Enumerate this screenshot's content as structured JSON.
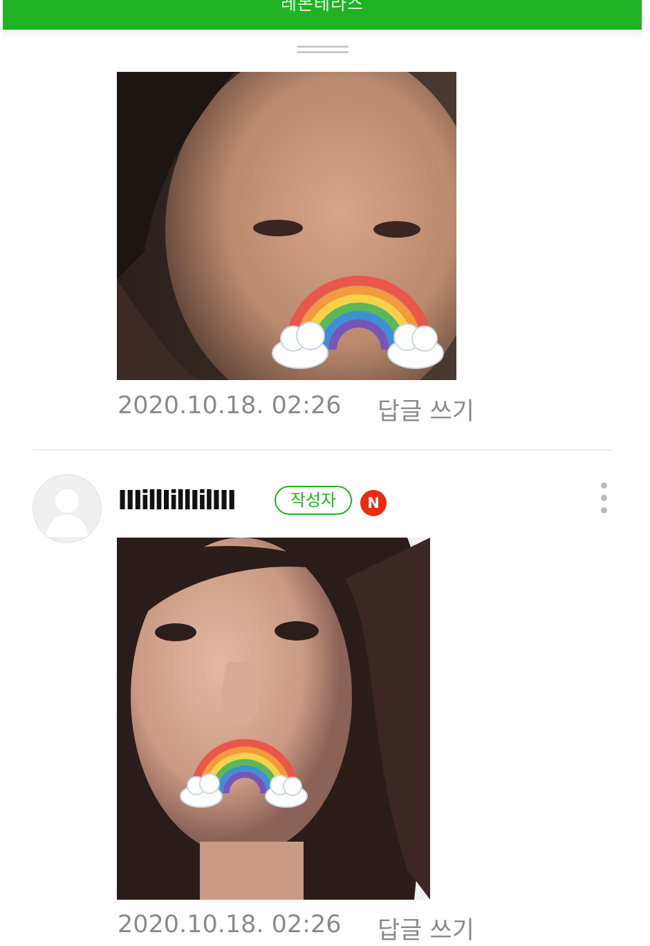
{
  "header": {
    "title": "레몬테라스",
    "background_color": "#1fb324",
    "back_icon": "chevron-left-icon"
  },
  "comments": [
    {
      "photo_description_icon": "photo-with-rainbow-sticker",
      "timestamp": "2020.10.18. 02:26",
      "reply_label": "답글 쓰기"
    },
    {
      "author": "IIIillIillIilIII",
      "writer_badge": "작성자",
      "new_badge": "N",
      "avatar_icon": "default-profile-icon",
      "more_icon": "more-vertical-icon",
      "photo_description_icon": "photo-with-rainbow-sticker",
      "timestamp": "2020.10.18. 02:26",
      "reply_label": "답글 쓰기"
    }
  ],
  "colors": {
    "accent": "#1fb324",
    "new_badge": "#ee2a12",
    "meta_text": "#8a8a8a"
  }
}
